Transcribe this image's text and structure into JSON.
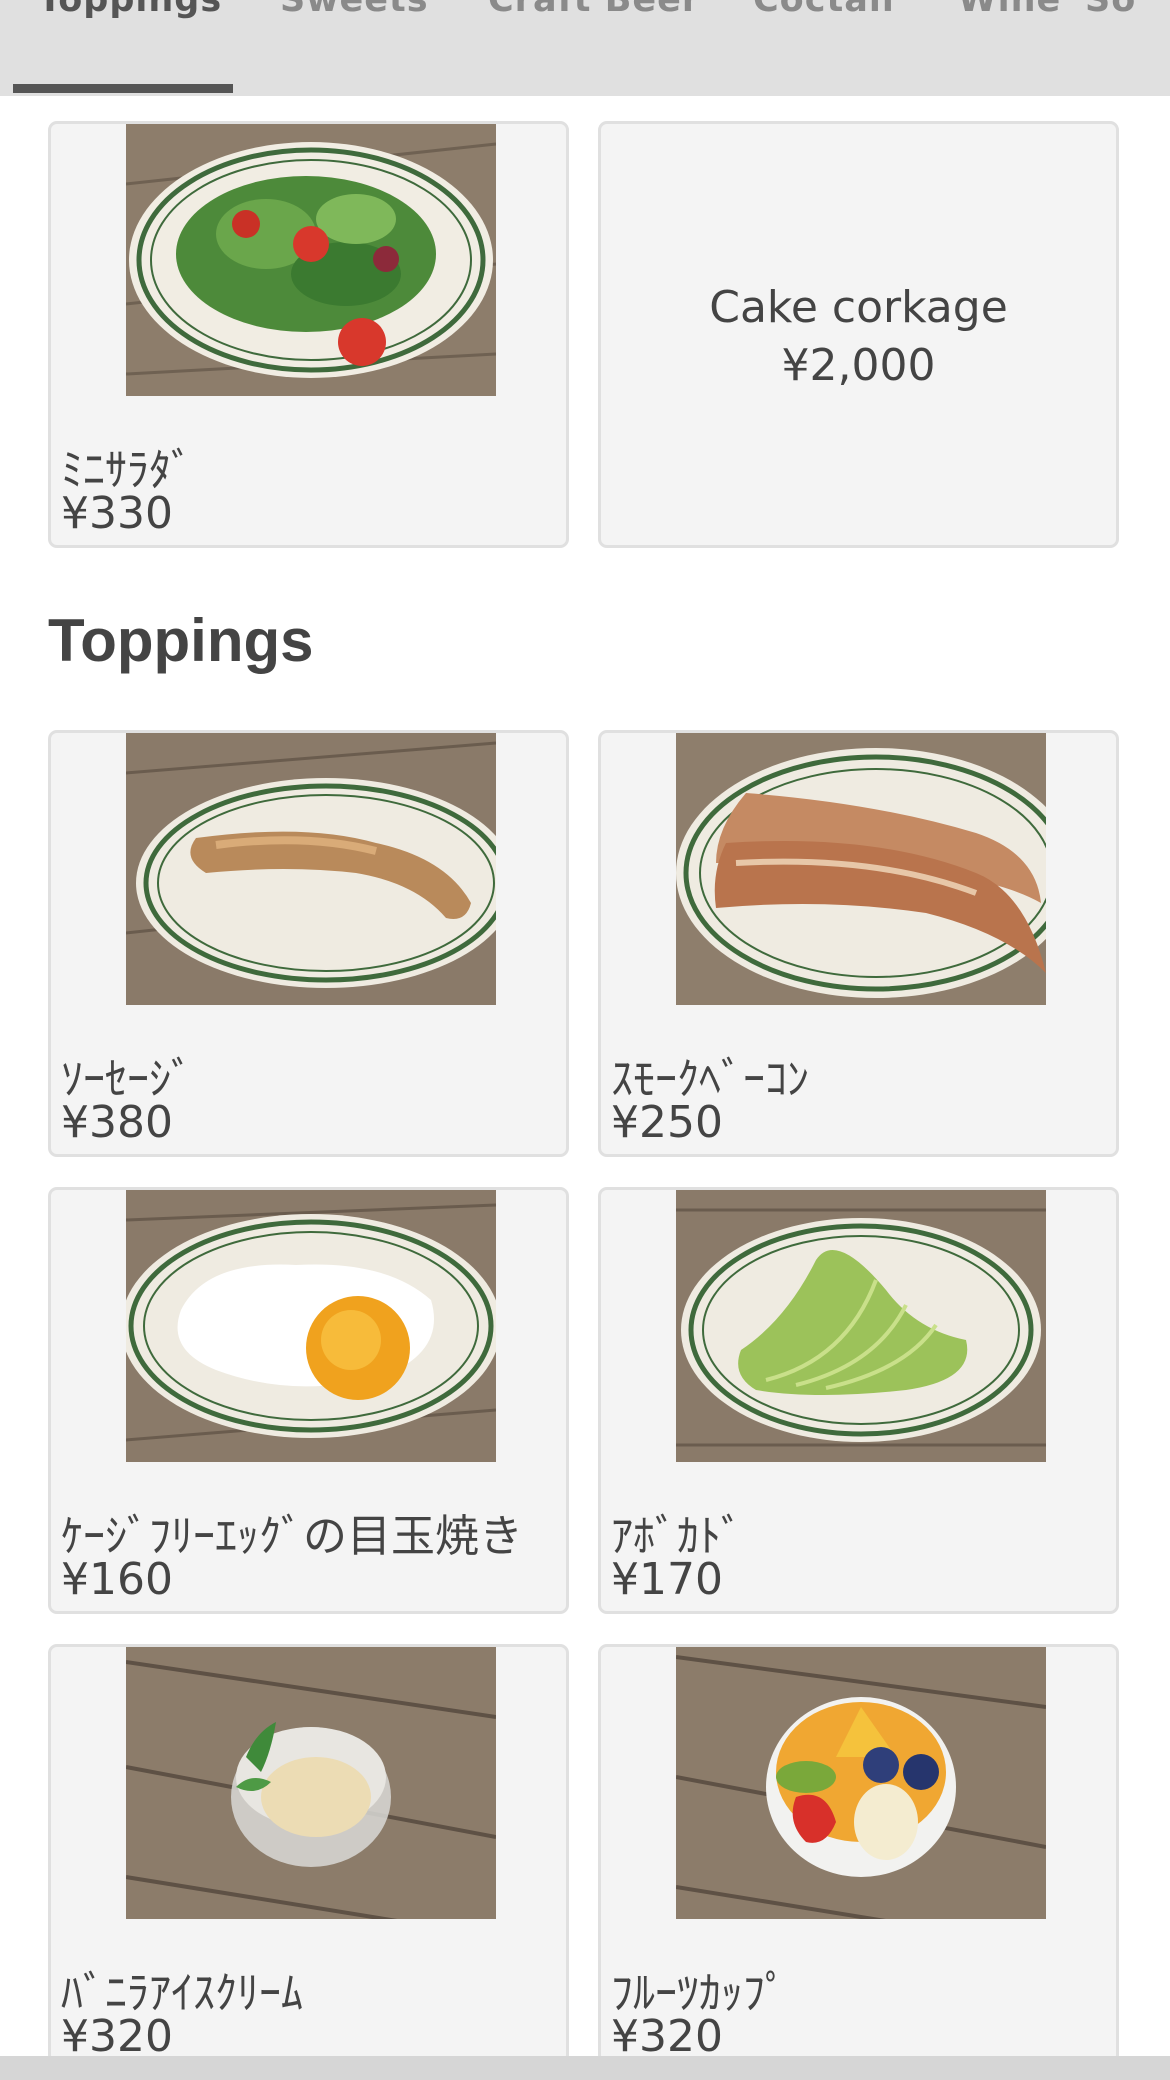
{
  "tabs": [
    {
      "label": "Toppings",
      "active": true
    },
    {
      "label": "Sweets",
      "active": false
    },
    {
      "label": "Craft Beer",
      "active": false
    },
    {
      "label": "Coctail",
      "active": false
    },
    {
      "label": "Wine",
      "active": false
    },
    {
      "label": "So",
      "active": false
    }
  ],
  "top_cards": [
    {
      "name": "ﾐﾆｻﾗﾀﾞ",
      "price": "¥330",
      "image": "mini-salad-photo"
    },
    {
      "name": "Cake corkage",
      "price": "¥2,000"
    }
  ],
  "section_title": "Toppings",
  "toppings": [
    {
      "name": "ｿｰｾｰｼﾞ",
      "price": "¥380",
      "image": "sausage-photo"
    },
    {
      "name": "ｽﾓｰｸﾍﾞｰｺﾝ",
      "price": "¥250",
      "image": "smoked-bacon-photo"
    },
    {
      "name": "ｹｰｼﾞﾌﾘｰｴｯｸﾞの目玉焼き",
      "price": "¥160",
      "image": "fried-egg-photo"
    },
    {
      "name": "ｱﾎﾞｶﾄﾞ",
      "price": "¥170",
      "image": "avocado-photo"
    },
    {
      "name": "ﾊﾞﾆﾗｱｲｽｸﾘｰﾑ",
      "price": "¥320",
      "image": "vanilla-ice-cream-photo"
    },
    {
      "name": "ﾌﾙｰﾂｶｯﾌﾟ",
      "price": "¥320",
      "image": "fruit-cup-photo"
    }
  ],
  "colors": {
    "tab_bar": "#e0e0e0",
    "tab_indicator": "#555555",
    "card_bg": "#f4f4f4",
    "card_border": "#e0e0e0",
    "text": "#444444",
    "wood": "#8b7b6a",
    "plate_stripe": "#3f6a3c"
  }
}
